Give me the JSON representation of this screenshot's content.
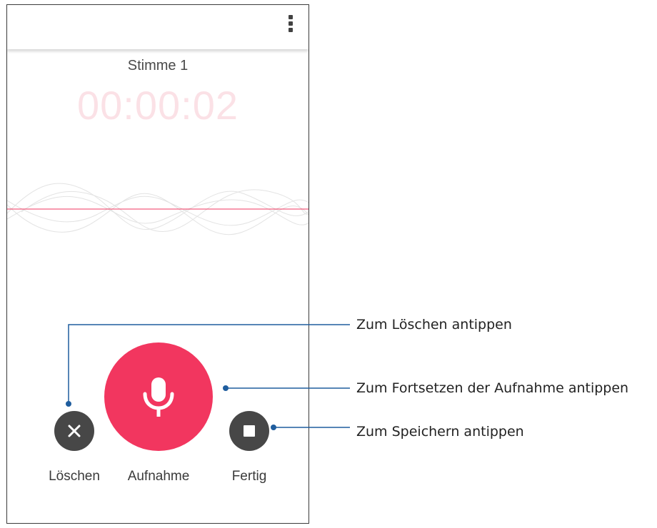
{
  "recorder": {
    "recording_name": "Stimme 1",
    "elapsed_time": "00:00:02",
    "controls": {
      "delete_label": "Löschen",
      "record_label": "Aufnahme",
      "done_label": "Fertig"
    },
    "icons": {
      "menu": "overflow-menu-icon",
      "delete": "close-icon",
      "record": "microphone-icon",
      "done": "stop-icon"
    },
    "colors": {
      "accent": "#f2365f",
      "timer": "#fbe1e6",
      "dark_button": "#474747",
      "callout_line": "#1f5d9e"
    }
  },
  "callouts": {
    "delete": "Zum Löschen antippen",
    "resume": "Zum Fortsetzen der Aufnahme antippen",
    "save": "Zum Speichern antippen"
  }
}
